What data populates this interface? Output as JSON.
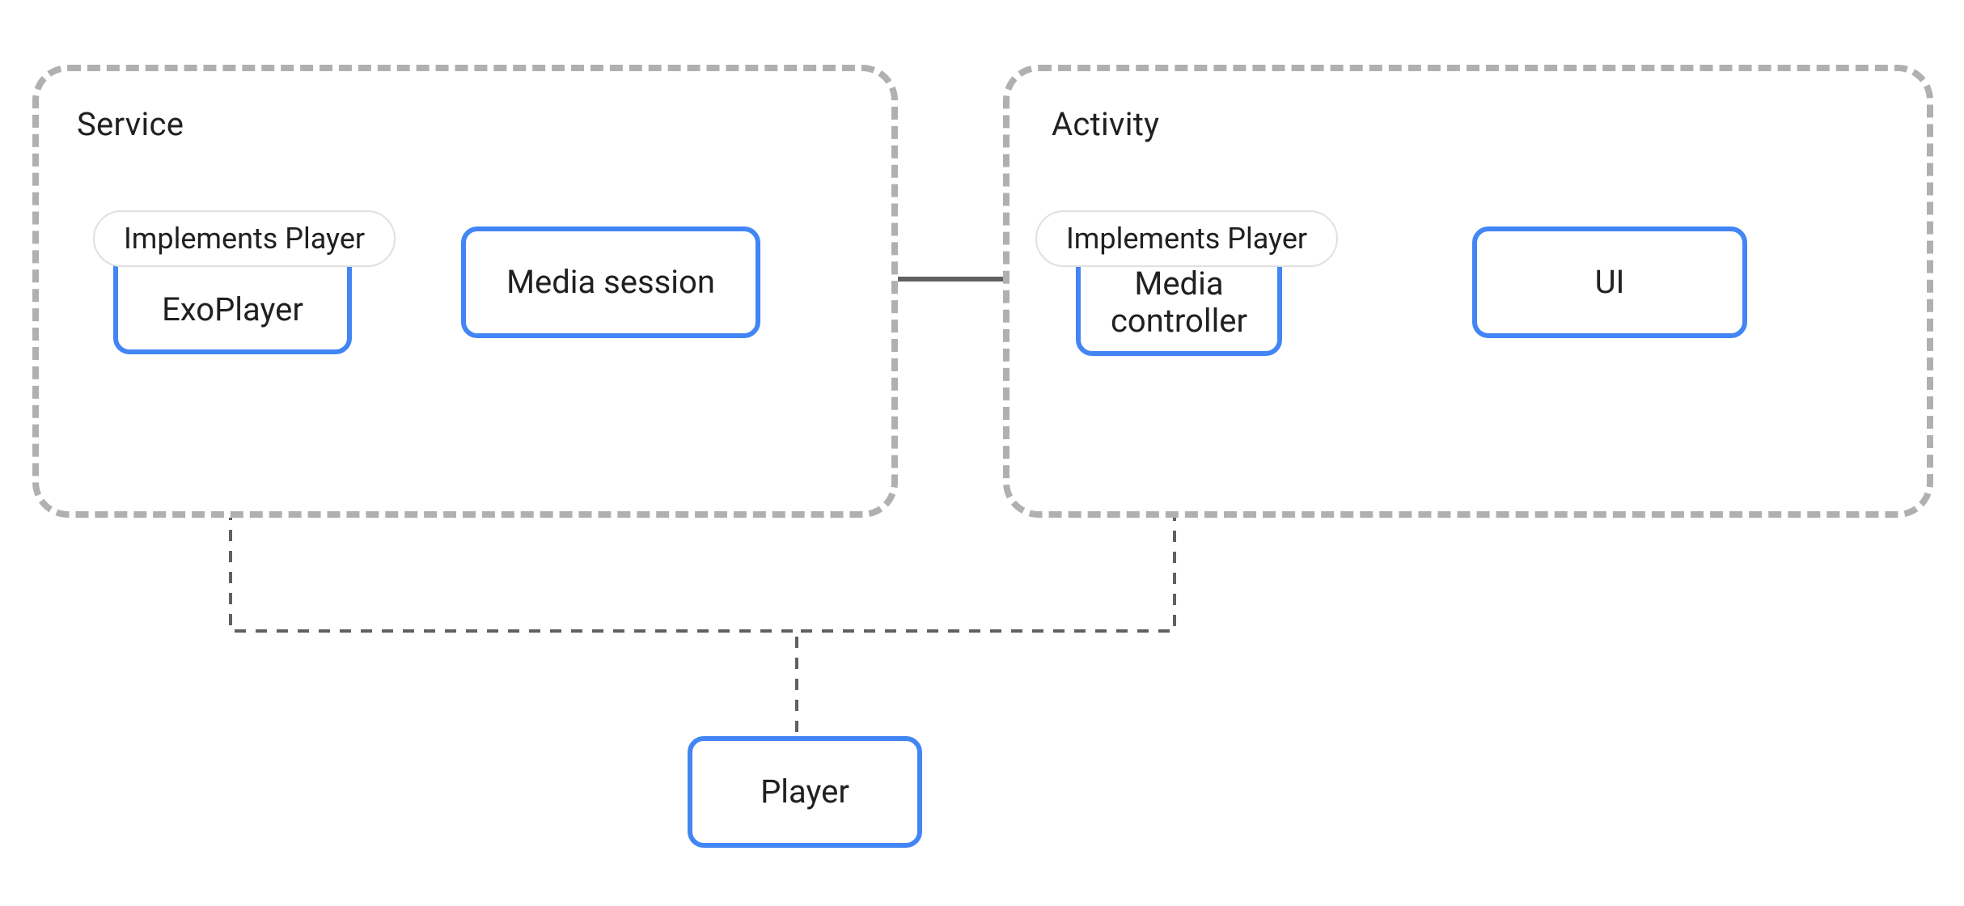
{
  "colors": {
    "node_border": "#4285f4",
    "container_border": "#b0b0b0",
    "arrow": "#606060",
    "dashed_line": "#606060",
    "text": "#202020",
    "chip_border": "#e0e0e0"
  },
  "containers": {
    "service": {
      "label": "Service"
    },
    "activity": {
      "label": "Activity"
    }
  },
  "chips": {
    "exoplayer_implements": "Implements Player",
    "mediacontroller_implements": "Implements Player"
  },
  "nodes": {
    "exoplayer": "ExoPlayer",
    "media_session": "Media session",
    "media_controller": "Media\ncontroller",
    "ui": "UI",
    "player": "Player"
  },
  "relations": {
    "session_to_controller": {
      "type": "double-arrow-solid",
      "from": "media_session",
      "to": "media_controller"
    },
    "player_to_exoplayer": {
      "type": "generalization-dashed",
      "from": "player",
      "to": "exoplayer"
    },
    "player_to_mediacontroller": {
      "type": "generalization-dashed",
      "from": "player",
      "to": "media_controller"
    }
  }
}
